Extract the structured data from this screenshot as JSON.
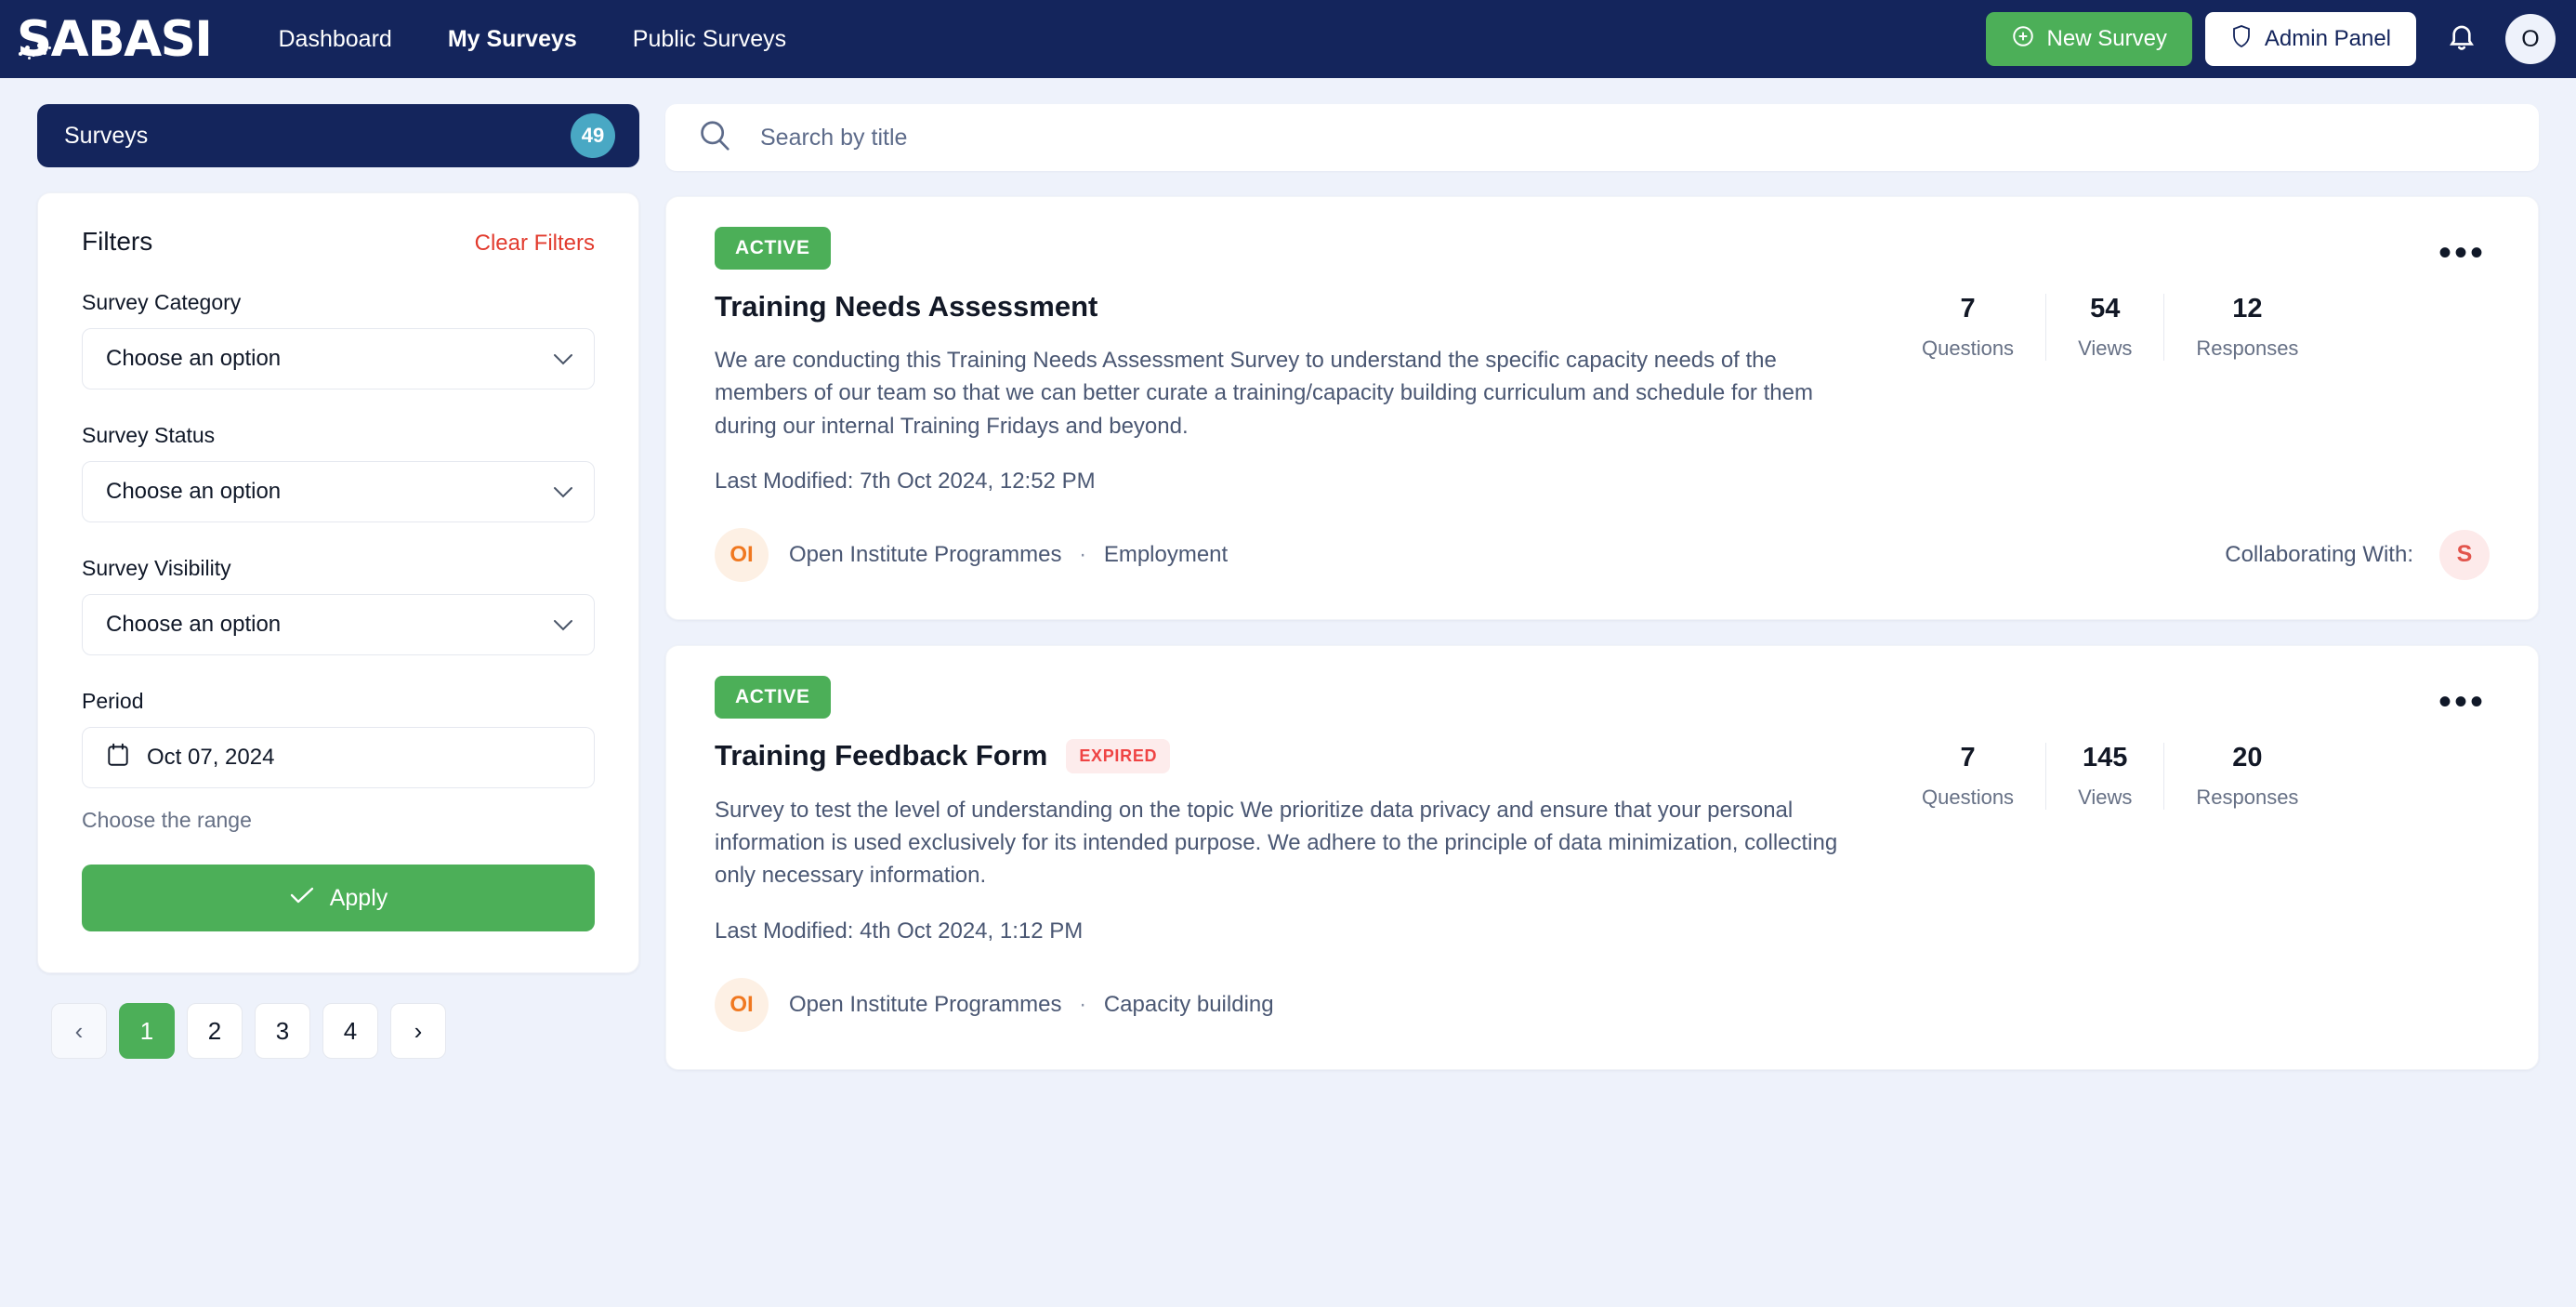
{
  "header": {
    "logo": "SABASI",
    "nav": [
      {
        "label": "Dashboard",
        "active": false
      },
      {
        "label": "My Surveys",
        "active": true
      },
      {
        "label": "Public Surveys",
        "active": false
      }
    ],
    "new_survey_label": "New Survey",
    "admin_panel_label": "Admin Panel",
    "avatar_initial": "O",
    "brand_color": "#14255c",
    "accent_green": "#4caf58"
  },
  "sidebar": {
    "surveys_label": "Surveys",
    "surveys_count": "49",
    "filters_title": "Filters",
    "clear_filters_label": "Clear Filters",
    "fields": {
      "category_label": "Survey Category",
      "category_value": "Choose an option",
      "status_label": "Survey Status",
      "status_value": "Choose an option",
      "visibility_label": "Survey Visibility",
      "visibility_value": "Choose an option",
      "period_label": "Period",
      "period_value": "Oct 07, 2024",
      "range_hint": "Choose the range"
    },
    "apply_label": "Apply",
    "pagination": {
      "prev": "‹",
      "pages": [
        "1",
        "2",
        "3",
        "4"
      ],
      "current": "1",
      "next": "›"
    }
  },
  "search": {
    "placeholder": "Search by title",
    "value": ""
  },
  "cards": [
    {
      "status": "ACTIVE",
      "title": "Training Needs Assessment",
      "expired": null,
      "description": "We are conducting this Training Needs Assessment Survey to understand the specific capacity needs of the members of our team so that we can better curate a training/capacity building curriculum and schedule for them during our internal Training Fridays and beyond.",
      "last_modified": "Last Modified: 7th Oct 2024, 12:52 PM",
      "stats": [
        {
          "num": "7",
          "label": "Questions"
        },
        {
          "num": "54",
          "label": "Views"
        },
        {
          "num": "12",
          "label": "Responses"
        }
      ],
      "org_initials": "OI",
      "org_name": "Open Institute Programmes",
      "org_separator": "·",
      "org_category": "Employment",
      "collaborating_label": "Collaborating With:",
      "collaborator_initial": "S",
      "menu_icon": "•••"
    },
    {
      "status": "ACTIVE",
      "title": "Training Feedback Form",
      "expired": "EXPIRED",
      "description": "Survey to test the level of understanding on the topic We prioritize data privacy and ensure that your personal information is used exclusively for its intended purpose. We adhere to the principle of data minimization, collecting only necessary information.",
      "last_modified": "Last Modified: 4th Oct 2024, 1:12 PM",
      "stats": [
        {
          "num": "7",
          "label": "Questions"
        },
        {
          "num": "145",
          "label": "Views"
        },
        {
          "num": "20",
          "label": "Responses"
        }
      ],
      "org_initials": "OI",
      "org_name": "Open Institute Programmes",
      "org_separator": "·",
      "org_category": "Capacity building",
      "collaborating_label": "",
      "collaborator_initial": "",
      "menu_icon": "•••"
    }
  ]
}
